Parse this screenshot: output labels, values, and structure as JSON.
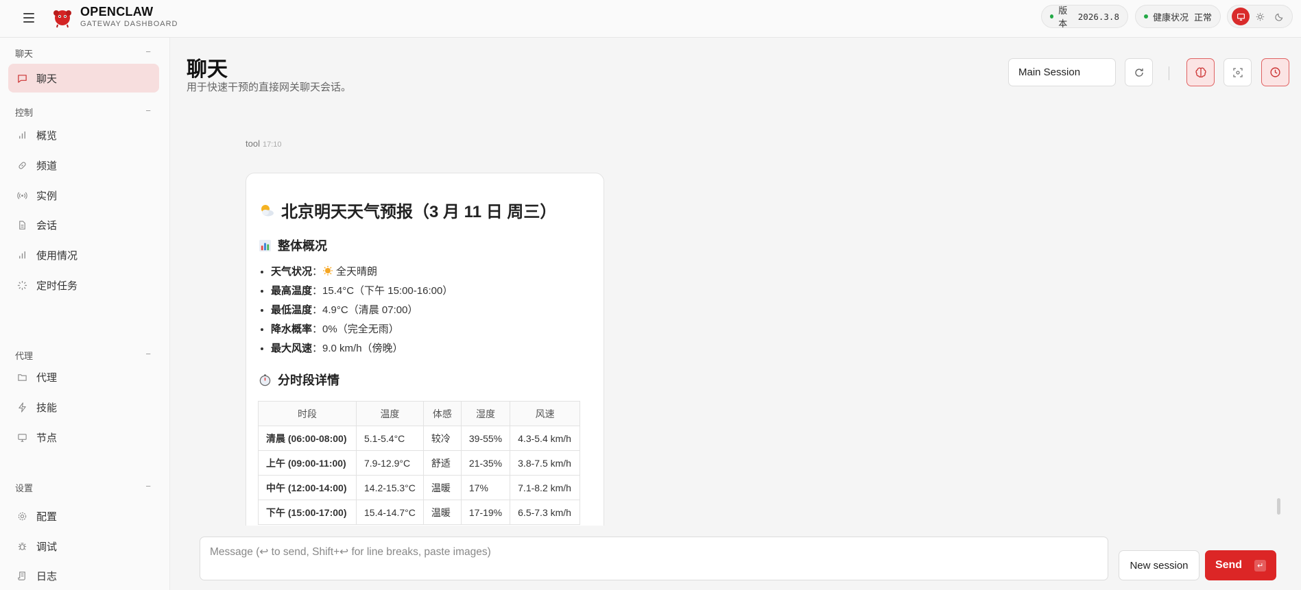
{
  "header": {
    "brand_name": "OPENCLAW",
    "brand_sub": "GATEWAY DASHBOARD",
    "version_label": "版本",
    "version_value": "2026.3.8",
    "health_label": "健康状况",
    "health_value": "正常"
  },
  "sidebar": {
    "sections": [
      {
        "title": "聊天",
        "collapse": "−",
        "items": [
          {
            "label": "聊天",
            "icon": "message-square-icon"
          }
        ]
      },
      {
        "title": "控制",
        "collapse": "−",
        "items": [
          {
            "label": "概览",
            "icon": "bar-chart-icon"
          },
          {
            "label": "频道",
            "icon": "link-icon"
          },
          {
            "label": "实例",
            "icon": "radio-icon"
          },
          {
            "label": "会话",
            "icon": "file-icon"
          },
          {
            "label": "使用情况",
            "icon": "bar-chart-icon"
          },
          {
            "label": "定时任务",
            "icon": "loader-icon"
          }
        ]
      },
      {
        "title": "代理",
        "collapse": "−",
        "items": [
          {
            "label": "代理",
            "icon": "folder-icon"
          },
          {
            "label": "技能",
            "icon": "zap-icon"
          },
          {
            "label": "节点",
            "icon": "monitor-icon"
          }
        ]
      },
      {
        "title": "设置",
        "collapse": "−",
        "items": [
          {
            "label": "配置",
            "icon": "gear-icon"
          },
          {
            "label": "调试",
            "icon": "bug-icon"
          },
          {
            "label": "日志",
            "icon": "scroll-icon"
          }
        ]
      }
    ]
  },
  "main": {
    "title": "聊天",
    "subtitle": "用于快速干预的直接网关聊天会话。",
    "session_select": "Main Session"
  },
  "message": {
    "sender": "tool",
    "time": "17:10",
    "heading": "北京明天天气预报（3 月 11 日 周三）",
    "overview_title": "整体概况",
    "bullets": [
      {
        "key": "天气状况",
        "value": "全天晴朗",
        "sun": true
      },
      {
        "key": "最高温度",
        "value": "15.4°C（下午 15:00-16:00）"
      },
      {
        "key": "最低温度",
        "value": "4.9°C（清晨 07:00）"
      },
      {
        "key": "降水概率",
        "value": "0%（完全无雨）"
      },
      {
        "key": "最大风速",
        "value": "9.0 km/h（傍晚）"
      }
    ],
    "detail_title": "分时段详情",
    "table_headers": [
      "时段",
      "温度",
      "体感",
      "湿度",
      "风速"
    ],
    "table_rows": [
      [
        "清晨 (06:00-08:00)",
        "5.1-5.4°C",
        "较冷",
        "39-55%",
        "4.3-5.4 km/h"
      ],
      [
        "上午 (09:00-11:00)",
        "7.9-12.9°C",
        "舒适",
        "21-35%",
        "3.8-7.5 km/h"
      ],
      [
        "中午 (12:00-14:00)",
        "14.2-15.3°C",
        "温暖",
        "17%",
        "7.1-8.2 km/h"
      ],
      [
        "下午 (15:00-17:00)",
        "15.4-14.7°C",
        "温暖",
        "17-19%",
        "6.5-7.3 km/h"
      ]
    ]
  },
  "composer": {
    "placeholder": "Message (↩ to send, Shift+↩ for line breaks, paste images)",
    "new_session": "New session",
    "send": "Send",
    "send_key": "↵"
  },
  "colors": {
    "accent": "#dc2626",
    "active_nav_bg": "#f7dede",
    "status_ok": "#22a845"
  }
}
